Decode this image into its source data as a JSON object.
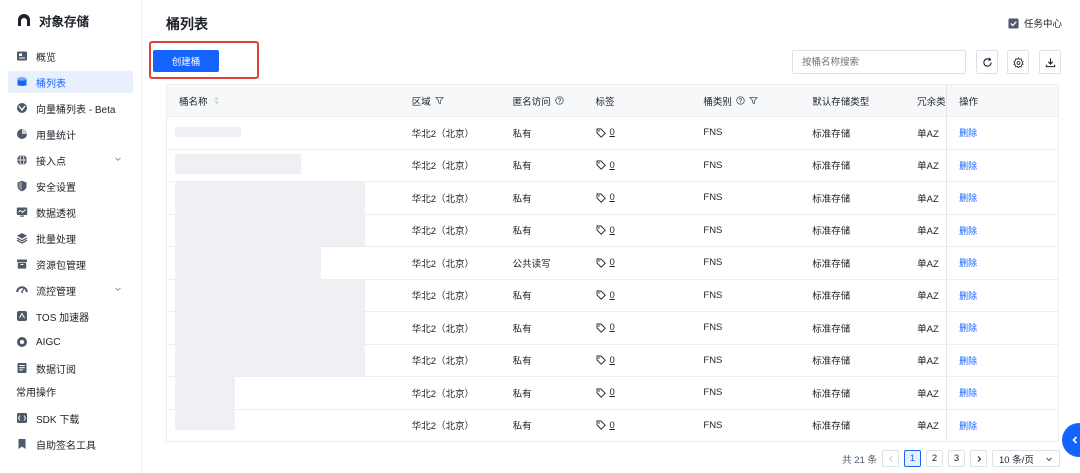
{
  "brand": {
    "title": "对象存储",
    "icon": "cloud-logo-icon"
  },
  "sidebar": {
    "items": [
      {
        "label": "概览",
        "icon": "overview-icon",
        "active": false
      },
      {
        "label": "桶列表",
        "icon": "bucket-icon",
        "active": true
      },
      {
        "label": "向量桶列表 - Beta",
        "icon": "vector-bucket-icon",
        "active": false
      },
      {
        "label": "用量统计",
        "icon": "chart-icon",
        "active": false
      },
      {
        "label": "接入点",
        "icon": "globe-icon",
        "active": false,
        "expandable": true
      },
      {
        "label": "安全设置",
        "icon": "shield-icon",
        "active": false
      },
      {
        "label": "数据透视",
        "icon": "monitor-icon",
        "active": false
      },
      {
        "label": "批量处理",
        "icon": "layers-icon",
        "active": false
      },
      {
        "label": "资源包管理",
        "icon": "package-icon",
        "active": false
      },
      {
        "label": "流控管理",
        "icon": "gauge-icon",
        "active": false,
        "expandable": true
      },
      {
        "label": "TOS 加速器",
        "icon": "accelerator-icon",
        "active": false
      },
      {
        "label": "AIGC",
        "icon": "aigc-icon",
        "active": false
      },
      {
        "label": "数据订阅",
        "icon": "subscription-icon",
        "active": false
      }
    ],
    "section_label": "常用操作",
    "common_items": [
      {
        "label": "SDK 下载",
        "icon": "sdk-icon"
      },
      {
        "label": "自助签名工具",
        "icon": "bookmark-icon"
      }
    ]
  },
  "header": {
    "title": "桶列表",
    "task_center": "任务中心"
  },
  "toolbar": {
    "create_label": "创建桶",
    "search_placeholder": "按桶名称搜索",
    "refresh_icon": "refresh-icon",
    "settings_icon": "gear-icon",
    "download_icon": "download-icon"
  },
  "table": {
    "columns": {
      "name": "桶名称",
      "region": "区域",
      "access": "匿名访问",
      "tags": "标签",
      "class": "桶类别",
      "storage": "默认存储类型",
      "redundancy": "冗余类",
      "ops": "操作"
    },
    "rows": [
      {
        "region": "华北2（北京）",
        "access": "私有",
        "tags": "0",
        "class": "FNS",
        "storage": "标准存储",
        "redundancy": "单AZ",
        "op": "删除"
      },
      {
        "region": "华北2（北京）",
        "access": "私有",
        "tags": "0",
        "class": "FNS",
        "storage": "标准存储",
        "redundancy": "单AZ",
        "op": "删除"
      },
      {
        "region": "华北2（北京）",
        "access": "私有",
        "tags": "0",
        "class": "FNS",
        "storage": "标准存储",
        "redundancy": "单AZ",
        "op": "删除"
      },
      {
        "region": "华北2（北京）",
        "access": "私有",
        "tags": "0",
        "class": "FNS",
        "storage": "标准存储",
        "redundancy": "单AZ",
        "op": "删除"
      },
      {
        "region": "华北2（北京）",
        "access": "公共读写",
        "tags": "0",
        "class": "FNS",
        "storage": "标准存储",
        "redundancy": "单AZ",
        "op": "删除"
      },
      {
        "region": "华北2（北京）",
        "access": "私有",
        "tags": "0",
        "class": "FNS",
        "storage": "标准存储",
        "redundancy": "单AZ",
        "op": "删除"
      },
      {
        "region": "华北2（北京）",
        "access": "私有",
        "tags": "0",
        "class": "FNS",
        "storage": "标准存储",
        "redundancy": "单AZ",
        "op": "删除"
      },
      {
        "region": "华北2（北京）",
        "access": "私有",
        "tags": "0",
        "class": "FNS",
        "storage": "标准存储",
        "redundancy": "单AZ",
        "op": "删除"
      },
      {
        "region": "华北2（北京）",
        "access": "私有",
        "tags": "0",
        "class": "FNS",
        "storage": "标准存储",
        "redundancy": "单AZ",
        "op": "删除"
      },
      {
        "region": "华北2（北京）",
        "access": "私有",
        "tags": "0",
        "class": "FNS",
        "storage": "标准存储",
        "redundancy": "单AZ",
        "op": "删除"
      }
    ]
  },
  "pagination": {
    "total": "共 21 条",
    "pages": [
      "1",
      "2",
      "3"
    ],
    "current": "1",
    "page_size": "10 条/页"
  },
  "colors": {
    "accent": "#1664ff",
    "highlight": "#e0403a"
  }
}
